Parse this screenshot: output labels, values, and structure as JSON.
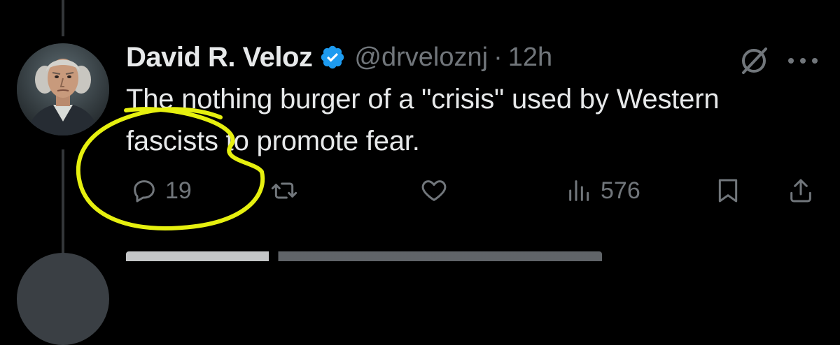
{
  "tweet": {
    "author": {
      "display_name": "David R. Veloz",
      "handle": "@drveloznj",
      "verified": true
    },
    "separator": "·",
    "time": "12h",
    "text": "The nothing burger of a \"crisis\" used by Western fascists to promote fear.",
    "actions": {
      "reply_count": "19",
      "retweet_count": "",
      "like_count": "",
      "view_count": "576"
    }
  },
  "icons": {
    "verified": "verified-badge-icon",
    "grok": "grok-icon",
    "more": "more-horizontal-icon",
    "reply": "reply-icon",
    "retweet": "retweet-icon",
    "like": "heart-icon",
    "views": "views-icon",
    "bookmark": "bookmark-icon",
    "share": "share-icon"
  },
  "colors": {
    "background": "#000000",
    "text_primary": "#e7e9ea",
    "text_secondary": "#71767b",
    "verified_blue": "#1d9bf0",
    "highlight_annotation": "#e6f00f"
  }
}
